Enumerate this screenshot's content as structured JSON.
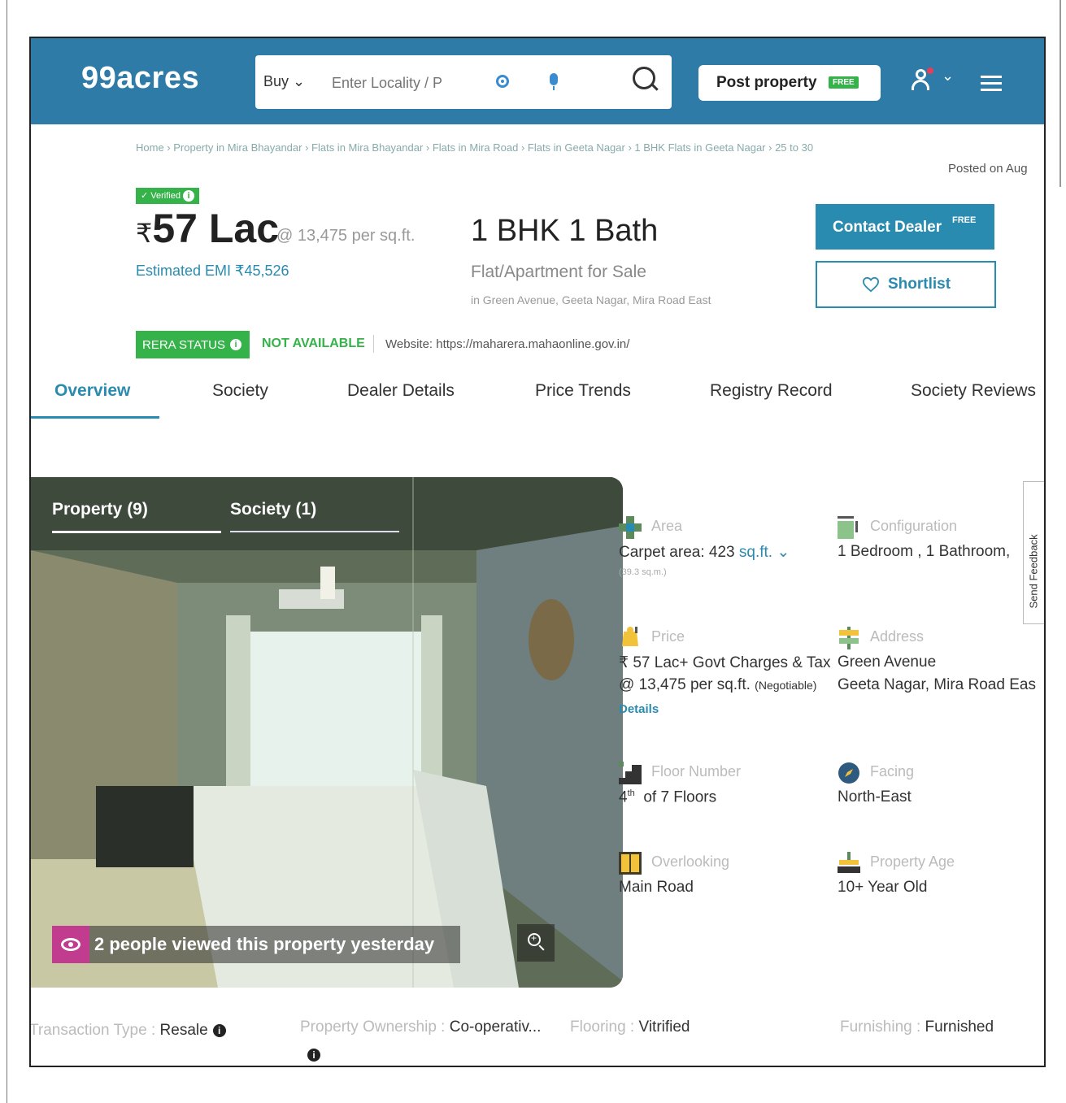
{
  "header": {
    "logo": "99acres",
    "search": {
      "mode": "Buy",
      "placeholder": "Enter Locality / P"
    },
    "post_property": {
      "label": "Post property",
      "badge": "FREE"
    }
  },
  "breadcrumb": "Home › Property in Mira Bhayandar › Flats in Mira Bhayandar › Flats in Mira Road › Flats in Geeta Nagar › 1 BHK Flats in Geeta Nagar › 25 to 30",
  "posted_on": "Posted on Aug",
  "listing": {
    "verified": "✓ Verified",
    "price_symbol": "₹",
    "price": "57 Lac",
    "per_sqft": "@ 13,475 per sq.ft.",
    "emi": "Estimated EMI ₹45,526",
    "configuration": "1 BHK 1 Bath",
    "type": "Flat/Apartment for Sale",
    "location": "in Green Avenue, Geeta Nagar, Mira Road East"
  },
  "actions": {
    "contact": {
      "label": "Contact Dealer",
      "badge": "FREE"
    },
    "shortlist": "Shortlist"
  },
  "rera": {
    "label": "RERA STATUS",
    "status": "NOT AVAILABLE",
    "website": "Website: https://maharera.mahaonline.gov.in/"
  },
  "tabs": [
    "Overview",
    "Society",
    "Dealer Details",
    "Price Trends",
    "Registry Record",
    "Society Reviews"
  ],
  "gallery": {
    "tab_property": "Property (9)",
    "tab_society": "Society (1)",
    "viewed": "2 people viewed this property yesterday"
  },
  "features": {
    "area": {
      "label": "Area",
      "value": "Carpet area: 423",
      "unit": "sq.ft.",
      "sub": "(39.3 sq.m.)"
    },
    "configuration": {
      "label": "Configuration",
      "value": "1 Bedroom , 1 Bathroom,"
    },
    "price": {
      "label": "Price",
      "value": "₹ 57 Lac+ Govt Charges & Tax",
      "sub": "@ 13,475 per sq.ft.",
      "sub_note": "(Negotiable)",
      "link": "Details"
    },
    "address": {
      "label": "Address",
      "value": "Green Avenue",
      "sub": "Geeta Nagar, Mira Road Eas"
    },
    "floor": {
      "label": "Floor Number",
      "floor": "4",
      "suffix": "th",
      "value": "of 7 Floors"
    },
    "facing": {
      "label": "Facing",
      "value": "North-East"
    },
    "overlooking": {
      "label": "Overlooking",
      "value": "Main Road"
    },
    "age": {
      "label": "Property Age",
      "value": "10+ Year Old"
    }
  },
  "feedback": "Send Feedback",
  "bottom": {
    "transaction_key": "Transaction Type : ",
    "transaction_val": "Resale",
    "ownership_key": "Property Ownership : ",
    "ownership_val": "Co-operativ...",
    "flooring_key": "Flooring : ",
    "flooring_val": "Vitrified",
    "furnishing_key": "Furnishing : ",
    "furnishing_val": "Furnished"
  },
  "colors": {
    "brand": "#2f7ba7",
    "accent": "#2a8bb0",
    "verified": "#36b24a",
    "viewed_badge": "#c13b8f"
  }
}
